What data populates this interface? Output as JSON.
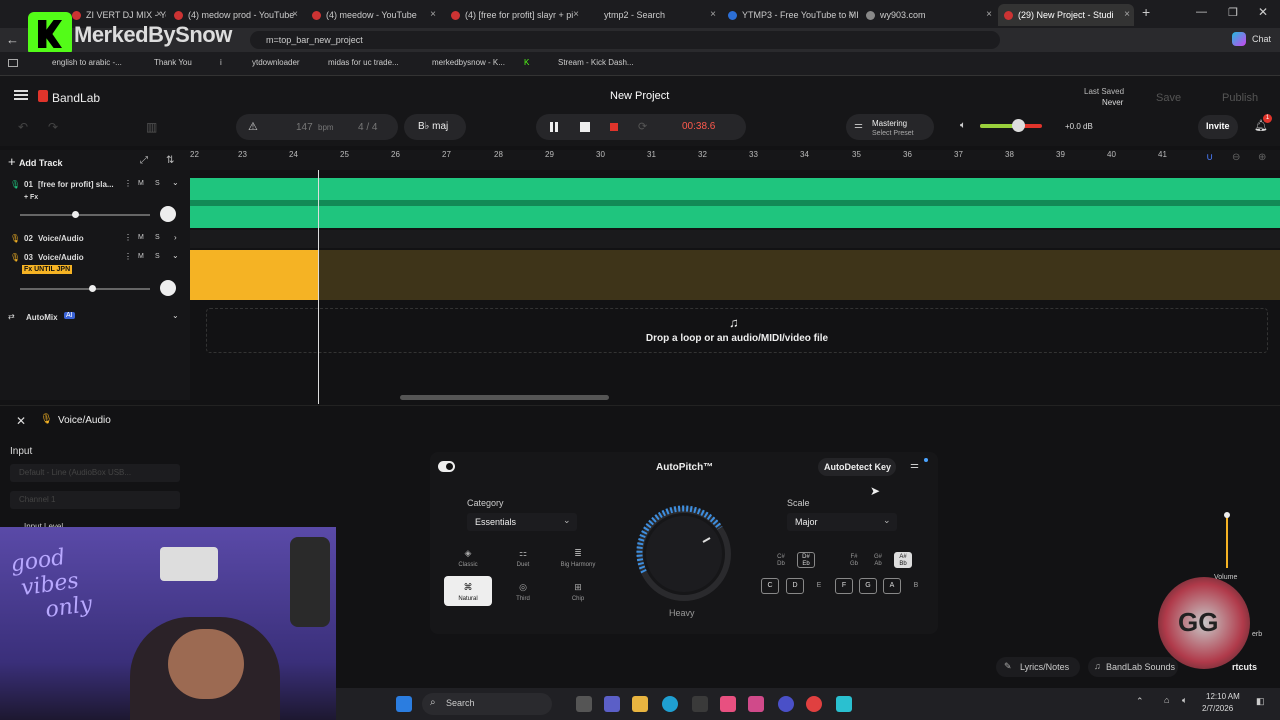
{
  "browser": {
    "tabs": [
      {
        "label": "ZI VERT DJ MIX - Yo"
      },
      {
        "label": "(4) medow prod - YouTube"
      },
      {
        "label": "(4) meedow - YouTube"
      },
      {
        "label": "(4) [free for profit] slayr + pi"
      },
      {
        "label": "ytmp2 - Search"
      },
      {
        "label": "YTMP3 - Free YouTube to MI"
      },
      {
        "label": "wy903.com"
      },
      {
        "label": "(29) New Project - Studi"
      }
    ],
    "address_fragment": "m=top_bar_new_project",
    "overlay_name": "MerkedBySnow",
    "chat_label": "Chat",
    "bookmarks": [
      "english to arabic -...",
      "Thank You",
      "i",
      "ytdownloader",
      "midas for uc trade...",
      "merkedbysnow - K...",
      "K",
      "Stream - Kick Dash..."
    ]
  },
  "app": {
    "brand": "BandLab",
    "project_title": "New Project",
    "last_saved_label": "Last Saved",
    "last_saved_value": "Never",
    "save_label": "Save",
    "publish_label": "Publish",
    "bpm_value": "147",
    "bpm_unit": "bpm",
    "time_signature": "4 / 4",
    "key_label": "B♭ maj",
    "time_display": "00:38.6",
    "mastering_label": "Mastering",
    "select_preset_label": "Select Preset",
    "master_volume": "+0.0 dB",
    "master_volume_level": 0.62,
    "invite_label": "Invite",
    "notification_count": "1",
    "add_track_label": "Add Track",
    "timeline_ticks": [
      "22",
      "23",
      "24",
      "25",
      "26",
      "27",
      "28",
      "29",
      "30",
      "31",
      "32",
      "33",
      "34",
      "35",
      "36",
      "37",
      "38",
      "39",
      "40",
      "41"
    ],
    "tracks": [
      {
        "num": "01",
        "name": "[free for profit] sla...",
        "fx": "+ Fx",
        "mute": "M",
        "solo": "S",
        "volume_level": 0.42
      },
      {
        "num": "02",
        "name": "Voice/Audio",
        "mute": "M",
        "solo": "S"
      },
      {
        "num": "03",
        "name": "Voice/Audio",
        "fx": "Fx UNTIL JPN",
        "mute": "M",
        "solo": "S",
        "volume_level": 0.55
      }
    ],
    "automix_label": "AutoMix",
    "automix_badge": "AI",
    "drop_text": "Drop a loop or an audio/MIDI/video file",
    "panel": {
      "track_label": "Voice/Audio",
      "input_label": "Input",
      "input_device": "Default - Line (AudioBox USB...",
      "channel": "Channel 1",
      "input_level_label": "Input Level",
      "autopitch_title": "AutoPitch™",
      "autodetect_label": "AutoDetect Key",
      "category_label": "Category",
      "category_value": "Essentials",
      "categories": [
        "Classic",
        "Duet",
        "Big Harmony",
        "Natural",
        "Third",
        "Chip"
      ],
      "selected_category": "Natural",
      "knob_label": "Heavy",
      "scale_label": "Scale",
      "scale_value": "Major",
      "black_keys": [
        {
          "top": "C#",
          "bottom": "Db"
        },
        {
          "top": "D#",
          "bottom": "Eb"
        },
        {
          "top": "F#",
          "bottom": "Gb"
        },
        {
          "top": "G#",
          "bottom": "Ab"
        },
        {
          "top": "A#",
          "bottom": "Bb"
        }
      ],
      "white_keys": [
        "C",
        "D",
        "E",
        "F",
        "G",
        "A",
        "B"
      ],
      "volume_label": "Volume",
      "reverb_label": "erb",
      "lyrics_label": "Lyrics/Notes",
      "sounds_label": "BandLab Sounds",
      "shortcuts_label": "rtcuts"
    }
  },
  "taskbar": {
    "search_label": "Search",
    "time": "12:10 AM",
    "date": "2/7/2026"
  },
  "colors": {
    "accent": "#1fc57e",
    "clip": "#f5b324",
    "record": "#e0342b",
    "time": "#ff5a4d"
  }
}
